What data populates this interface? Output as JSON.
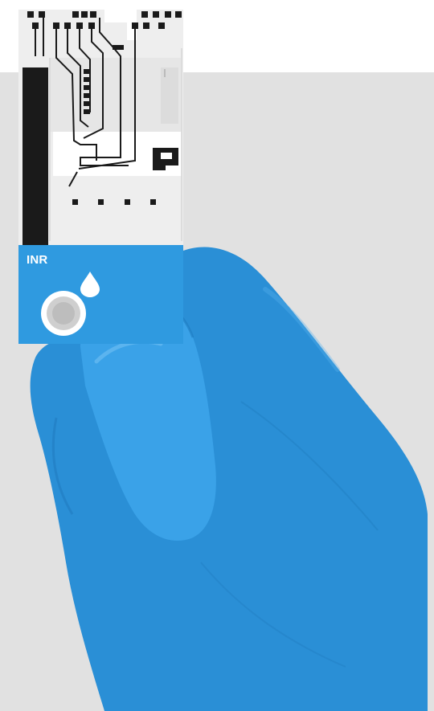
{
  "strip": {
    "label": "INR"
  },
  "colors": {
    "background_top": "#ffffff",
    "background_panel": "#e1e1e1",
    "strip_body": "#eeeeee",
    "strip_blue": "#2f9ae0",
    "glove": "#2a8fd6",
    "circuit": "#1a1a1a"
  },
  "icons": [
    "drop-icon",
    "sample-well-icon"
  ]
}
